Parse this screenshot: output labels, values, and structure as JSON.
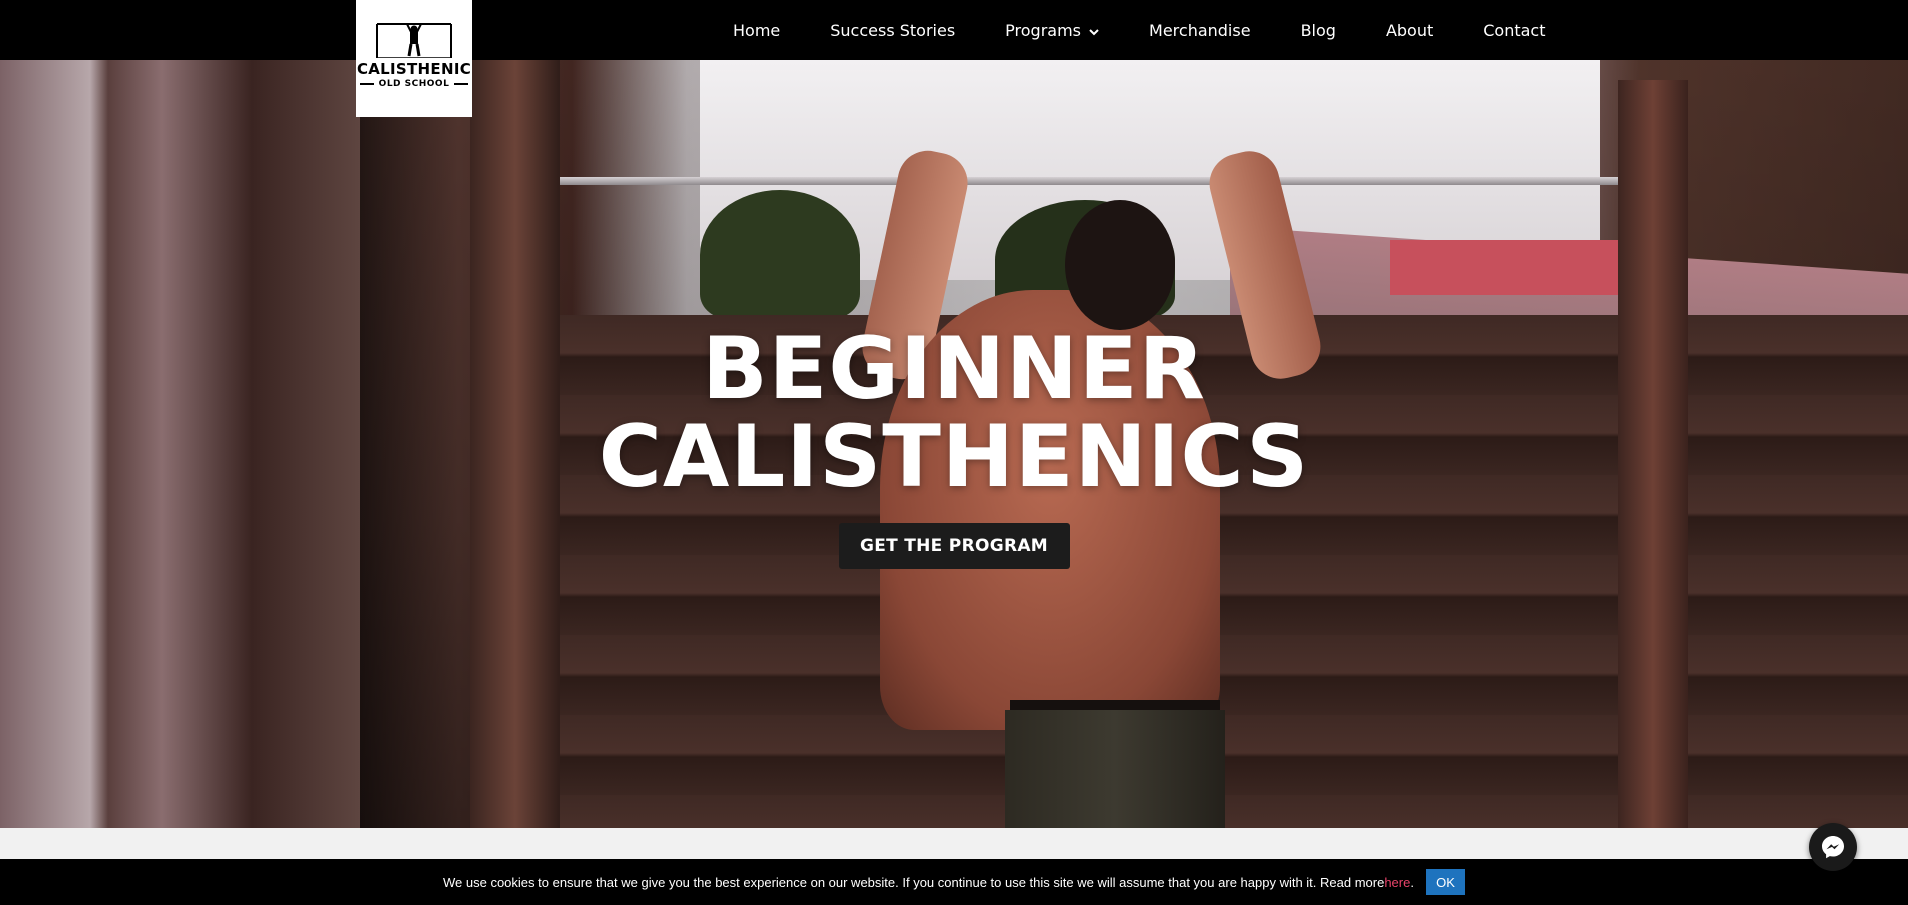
{
  "brand": {
    "logo_title": "CALISTHENIC",
    "logo_subtitle": "OLD SCHOOL"
  },
  "nav": {
    "items": [
      {
        "label": "Home"
      },
      {
        "label": "Success Stories"
      },
      {
        "label": "Programs",
        "has_dropdown": true
      },
      {
        "label": "Merchandise"
      },
      {
        "label": "Blog"
      },
      {
        "label": "About"
      },
      {
        "label": "Contact"
      }
    ]
  },
  "hero": {
    "title_line1": "BEGINNER",
    "title_line2": "CALISTHENICS",
    "cta_label": "GET THE PROGRAM"
  },
  "cookie": {
    "text": "We use cookies to ensure that we give you the best experience on our website. If you continue to use this site we will assume that you are happy with it. Read more ",
    "link_text": "here",
    "period": ".",
    "ok_label": "OK",
    "link_color": "#e8446a",
    "button_color": "#1e73be"
  },
  "chat": {
    "icon": "messenger-icon"
  }
}
